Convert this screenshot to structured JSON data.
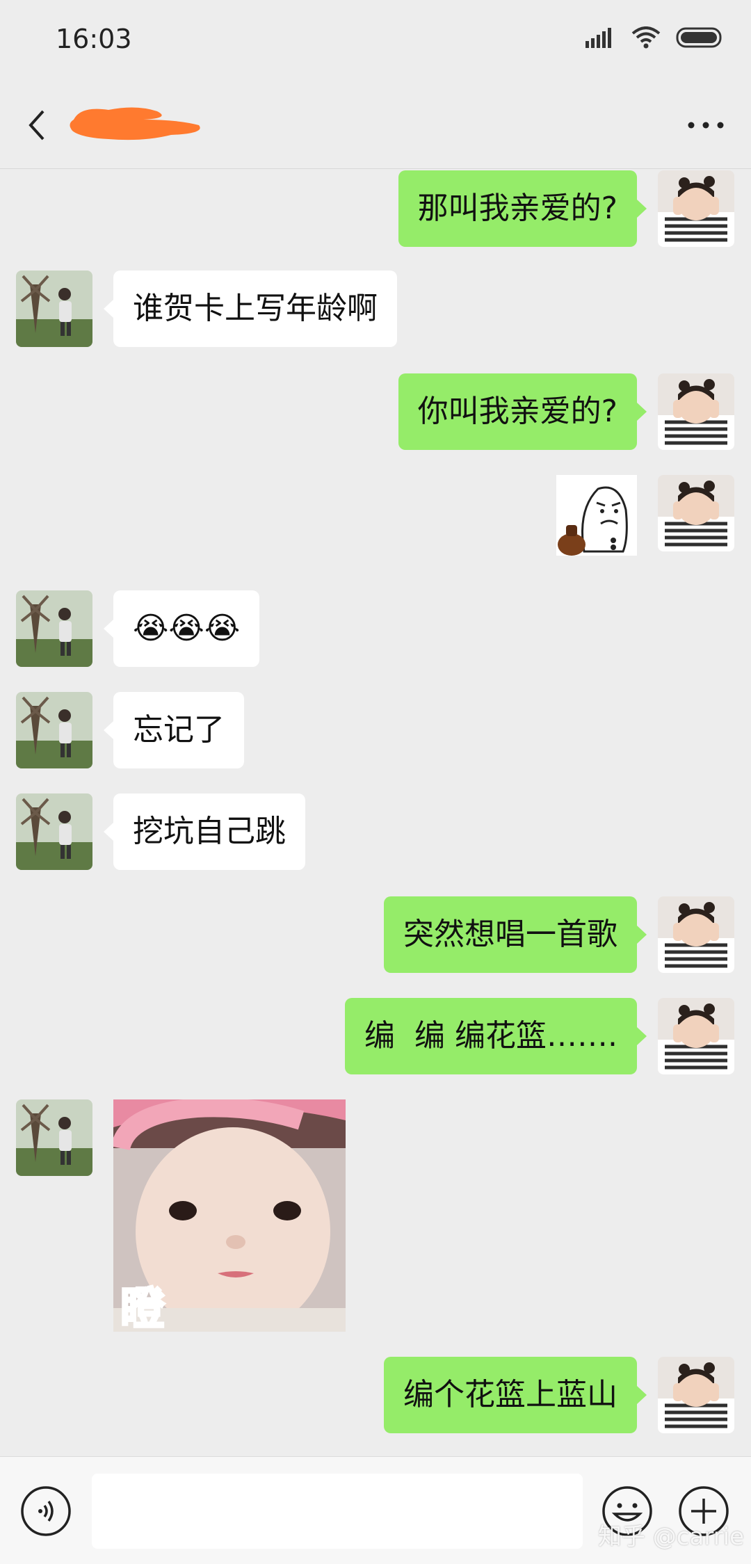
{
  "status_bar": {
    "time": "16:03"
  },
  "header": {
    "icons": [
      "back-icon",
      "more-icon"
    ]
  },
  "colors": {
    "outgoing_bubble": "#95ec69",
    "incoming_bubble": "#ffffff",
    "background": "#ededed"
  },
  "messages": [
    {
      "side": "out",
      "type": "text",
      "text": "那叫我亲爱的?"
    },
    {
      "side": "in",
      "type": "text",
      "text": "谁贺卡上写年龄啊"
    },
    {
      "side": "out",
      "type": "text",
      "text": "你叫我亲爱的?"
    },
    {
      "side": "out",
      "type": "sticker",
      "sticker": "meme-face-sticker"
    },
    {
      "side": "in",
      "type": "text",
      "text": "😭😭😭"
    },
    {
      "side": "in",
      "type": "text",
      "text": "忘记了"
    },
    {
      "side": "in",
      "type": "text",
      "text": "挖坑自己跳"
    },
    {
      "side": "out",
      "type": "text",
      "text": "突然想唱一首歌"
    },
    {
      "side": "out",
      "type": "text",
      "text": "编  编 编花篮……."
    },
    {
      "side": "in",
      "type": "sticker",
      "sticker": "baby-photo-sticker",
      "caption": "瞪"
    },
    {
      "side": "out",
      "type": "text",
      "text": "编个花篮上蓝山"
    }
  ],
  "input_bar": {
    "placeholder": "",
    "icons": [
      "voice-icon",
      "emoji-icon",
      "plus-icon"
    ]
  },
  "watermark": "知乎 @carrie"
}
